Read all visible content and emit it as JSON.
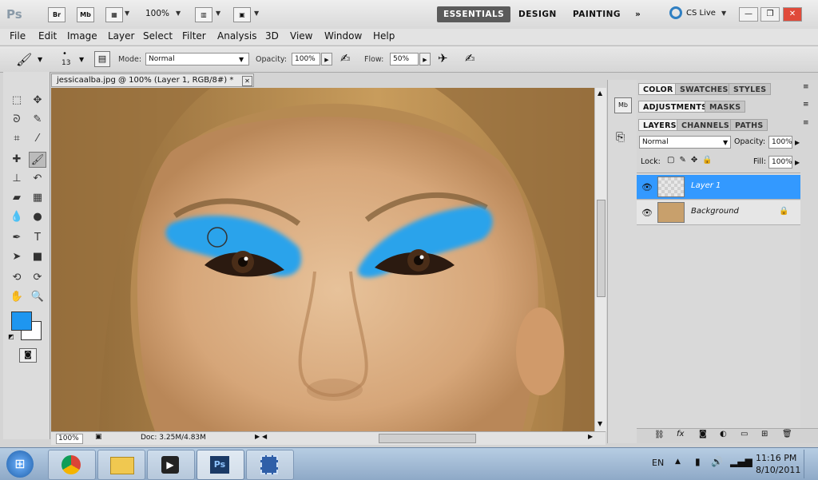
{
  "app": {
    "logo": "Ps",
    "bridge": "Br",
    "minibridge": "Mb",
    "zoom": "100%",
    "workspaces": [
      "ESSENTIALS",
      "DESIGN",
      "PAINTING"
    ],
    "more_workspaces": "»",
    "cs_live": "CS Live"
  },
  "menu": [
    "File",
    "Edit",
    "Image",
    "Layer",
    "Select",
    "Filter",
    "Analysis",
    "3D",
    "View",
    "Window",
    "Help"
  ],
  "options": {
    "brush_size": "13",
    "mode_label": "Mode:",
    "mode_value": "Normal",
    "opacity_label": "Opacity:",
    "opacity_value": "100%",
    "flow_label": "Flow:",
    "flow_value": "50%"
  },
  "document": {
    "tab_title": "jessicaalba.jpg @ 100% (Layer 1, RGB/8#) *",
    "status_zoom": "100%",
    "status_doc": "Doc: 3.25M/4.83M"
  },
  "colors": {
    "foreground": "#1e96f0",
    "background": "#ffffff",
    "eyeshadow": "#2aa3eb",
    "selection": "#3399ff"
  },
  "panels": {
    "group1": [
      "COLOR",
      "SWATCHES",
      "STYLES"
    ],
    "group2": [
      "ADJUSTMENTS",
      "MASKS"
    ],
    "group3": [
      "LAYERS",
      "CHANNELS",
      "PATHS"
    ],
    "blend_mode": "Normal",
    "opacity_label": "Opacity:",
    "opacity_value": "100%",
    "lock_label": "Lock:",
    "fill_label": "Fill:",
    "fill_value": "100%",
    "layers": [
      {
        "name": "Layer 1",
        "selected": true
      },
      {
        "name": "Background",
        "selected": false
      }
    ]
  },
  "taskbar": {
    "lang": "EN",
    "time": "11:16 PM",
    "date": "8/10/2011"
  }
}
